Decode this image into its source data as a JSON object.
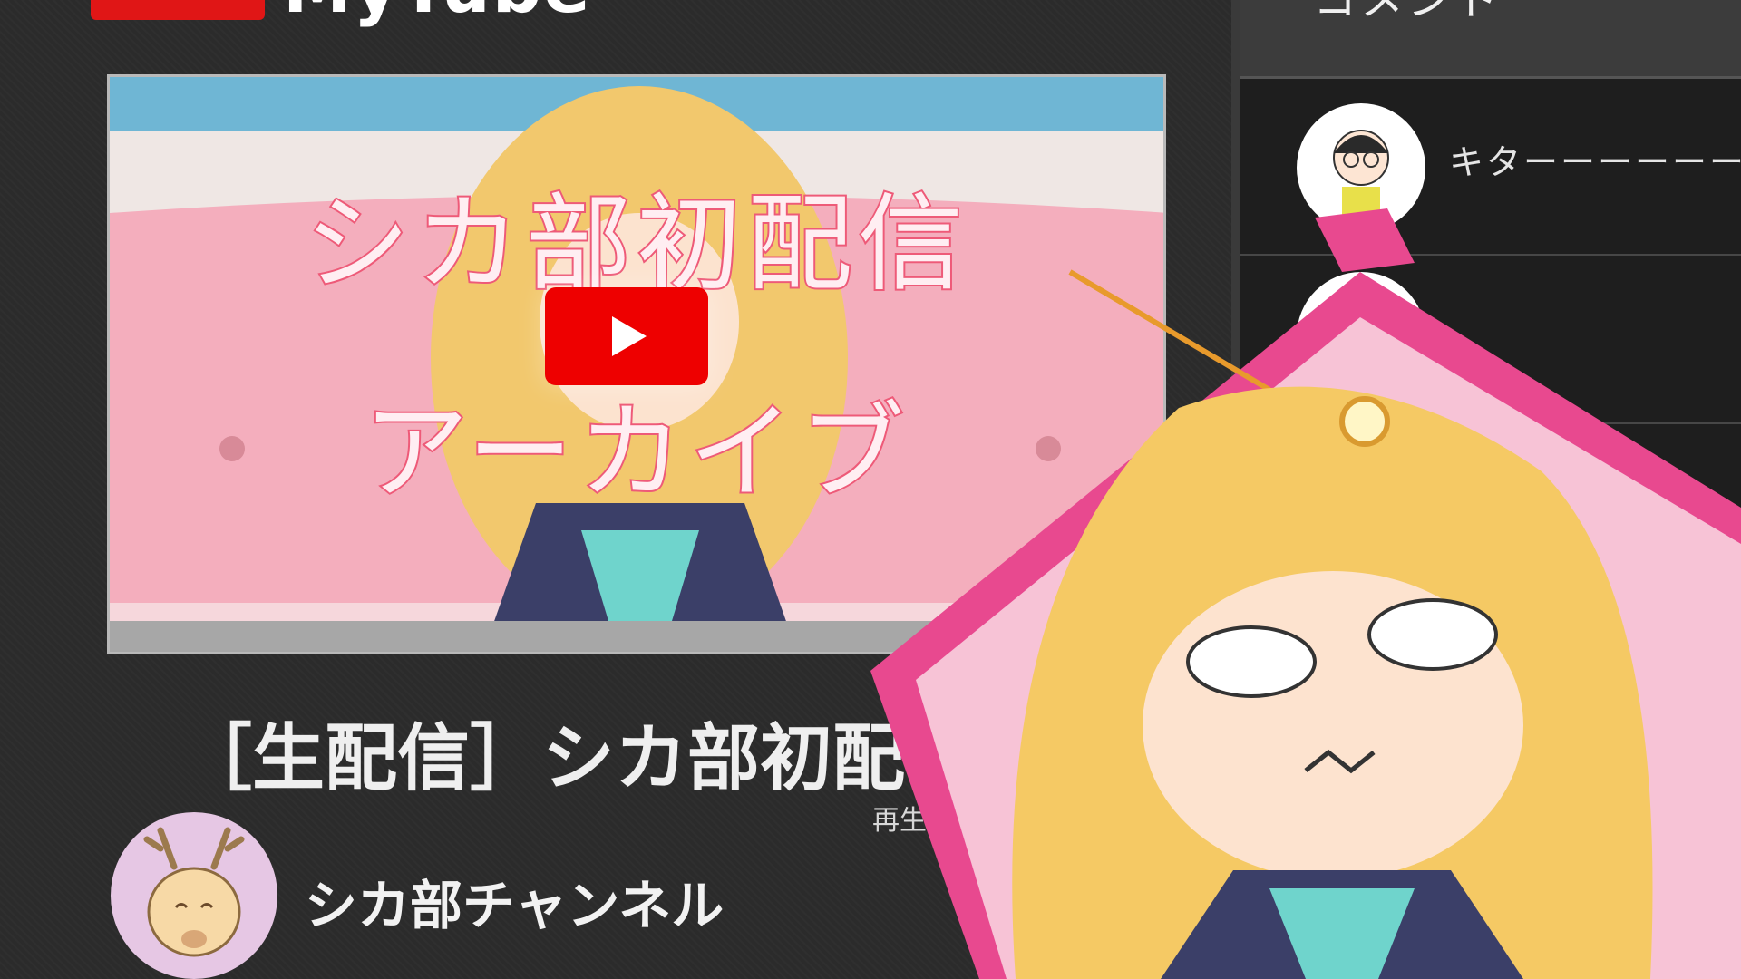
{
  "app": {
    "logo_text": "MyTube"
  },
  "player": {
    "overlay_line1": "シカ部初配信",
    "overlay_line2": "アーカイブ",
    "play_icon": "play-icon"
  },
  "video": {
    "title": "［生配信］シカ部初配信",
    "views_label": "再生数"
  },
  "channel": {
    "name": "シカ部チャンネル",
    "avatar_icon": "deer-icon"
  },
  "comments": {
    "header": "コメント",
    "items": [
      {
        "text": "キターーーーーー"
      },
      {
        "text": ""
      }
    ]
  },
  "colors": {
    "accent": "#ee0000",
    "overlay_stroke": "#ee5a78",
    "frame_pink": "#e8498f"
  }
}
